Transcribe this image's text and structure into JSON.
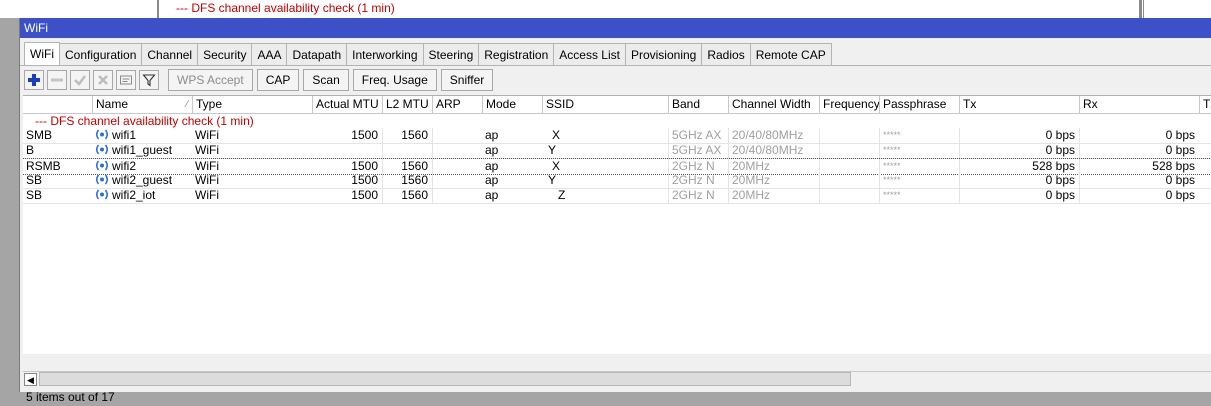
{
  "background": {
    "message": "--- DFS channel availability check (1 min)"
  },
  "window": {
    "title": "WiFi"
  },
  "tabs": [
    "WiFi",
    "Configuration",
    "Channel",
    "Security",
    "AAA",
    "Datapath",
    "Interworking",
    "Steering",
    "Registration",
    "Access List",
    "Provisioning",
    "Radios",
    "Remote CAP"
  ],
  "toolbar": {
    "icons": [
      "add-icon",
      "remove-icon",
      "enable-icon",
      "disable-icon",
      "comment-icon",
      "filter-icon"
    ],
    "buttons": {
      "wps": "WPS Accept",
      "cap": "CAP",
      "scan": "Scan",
      "freq": "Freq. Usage",
      "sniffer": "Sniffer"
    }
  },
  "table": {
    "columns": [
      "",
      "Name",
      "Type",
      "Actual MTU",
      "L2 MTU",
      "ARP",
      "Mode",
      "SSID",
      "Band",
      "Channel Width",
      "Frequency",
      "Passphrase",
      "Tx",
      "Rx",
      "Tx"
    ],
    "comment": "--- DFS channel availability check (1 min)",
    "rows": [
      {
        "flags": "SMB",
        "name": "wifi1",
        "type": "WiFi",
        "mtu": "1500",
        "l2mtu": "1560",
        "arp": "",
        "mode": "ap",
        "ssid": "X",
        "band": "5GHz AX",
        "width": "20/40/80MHz",
        "freq": "",
        "pass": "*****",
        "tx": "0 bps",
        "rx": "0 bps"
      },
      {
        "flags": "B",
        "name": "wifi1_guest",
        "type": "WiFi",
        "mtu": "",
        "l2mtu": "",
        "arp": "",
        "mode": "ap",
        "ssid": "Y",
        "band": "5GHz AX",
        "width": "20/40/80MHz",
        "freq": "",
        "pass": "*****",
        "tx": "0 bps",
        "rx": "0 bps"
      },
      {
        "flags": "RSMB",
        "name": "wifi2",
        "type": "WiFi",
        "mtu": "1500",
        "l2mtu": "1560",
        "arp": "",
        "mode": "ap",
        "ssid": "X",
        "band": "2GHz N",
        "width": "20MHz",
        "freq": "",
        "pass": "*****",
        "tx": "528 bps",
        "rx": "528 bps"
      },
      {
        "flags": "SB",
        "name": "wifi2_guest",
        "type": "WiFi",
        "mtu": "1500",
        "l2mtu": "1560",
        "arp": "",
        "mode": "ap",
        "ssid": "Y",
        "band": "2GHz N",
        "width": "20MHz",
        "freq": "",
        "pass": "*****",
        "tx": "0 bps",
        "rx": "0 bps"
      },
      {
        "flags": "SB",
        "name": "wifi2_iot",
        "type": "WiFi",
        "mtu": "1500",
        "l2mtu": "1560",
        "arp": "",
        "mode": "ap",
        "ssid": "Z",
        "band": "2GHz N",
        "width": "20MHz",
        "freq": "",
        "pass": "*****",
        "tx": "0 bps",
        "rx": "0 bps"
      }
    ]
  },
  "status": {
    "text": "5 items out of 17"
  },
  "colors": {
    "titlebar": "#3c50c8",
    "warning": "#c00000",
    "add": "#1a3fb8"
  }
}
